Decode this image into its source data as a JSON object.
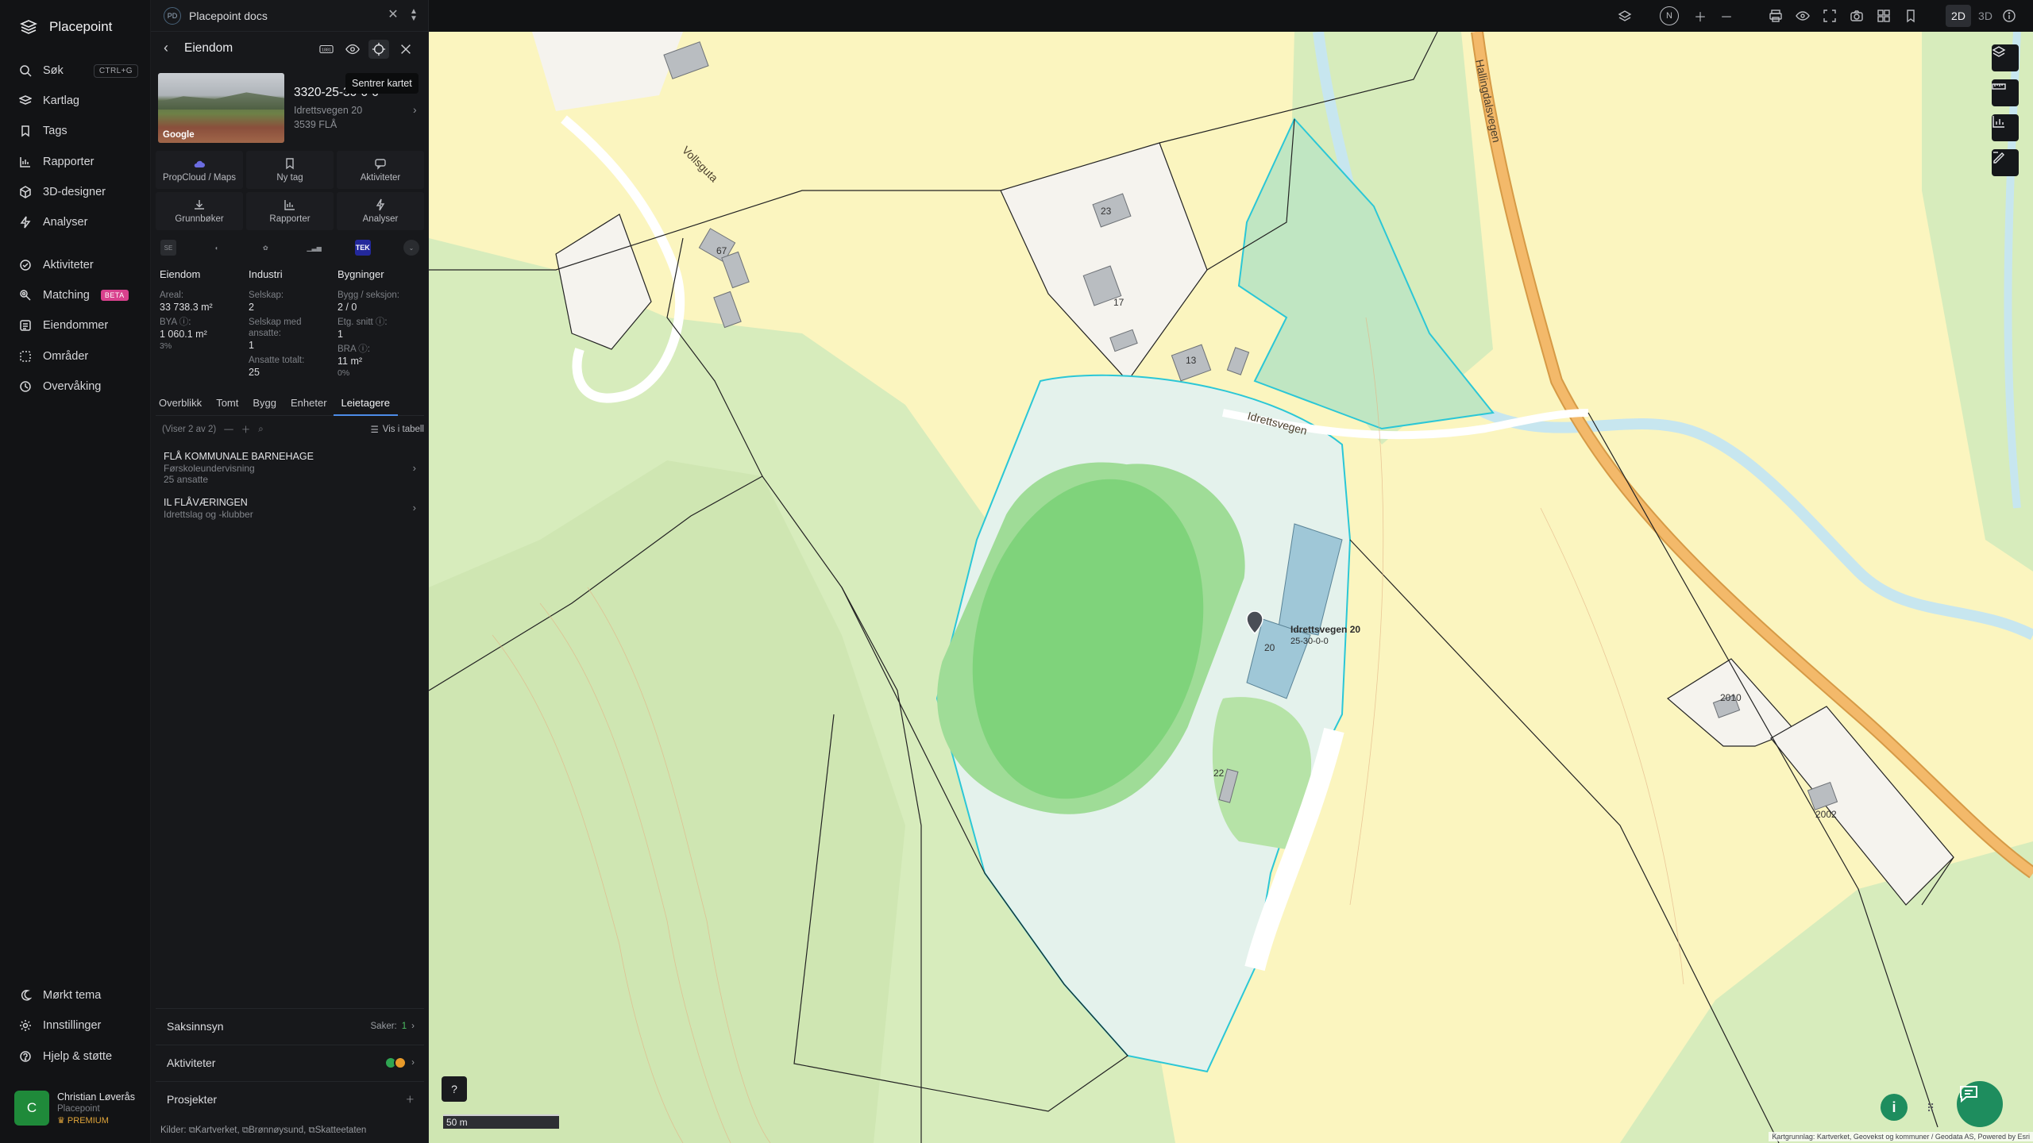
{
  "app": {
    "name": "Placepoint"
  },
  "nav": {
    "items": [
      {
        "label": "Søk",
        "icon": "search-icon",
        "shortcut": "CTRL+G"
      },
      {
        "label": "Kartlag",
        "icon": "layers-icon"
      },
      {
        "label": "Tags",
        "icon": "bookmark-icon"
      },
      {
        "label": "Rapporter",
        "icon": "chart-icon"
      },
      {
        "label": "3D-designer",
        "icon": "cube-icon"
      },
      {
        "label": "Analyser",
        "icon": "bolt-icon"
      },
      {
        "label": "Aktiviteter",
        "icon": "activity-icon"
      },
      {
        "label": "Matching",
        "icon": "target-icon",
        "badge": "BETA"
      },
      {
        "label": "Eiendommer",
        "icon": "list-icon"
      },
      {
        "label": "Områder",
        "icon": "area-icon"
      },
      {
        "label": "Overvåking",
        "icon": "monitor-icon"
      }
    ],
    "bottom": [
      {
        "label": "Mørkt tema",
        "icon": "moon-icon"
      },
      {
        "label": "Innstillinger",
        "icon": "gear-icon"
      },
      {
        "label": "Hjelp & støtte",
        "icon": "help-icon"
      }
    ],
    "user": {
      "initial": "C",
      "name": "Christian Løverås",
      "org": "Placepoint",
      "plan": "PREMIUM"
    }
  },
  "doc_tab": {
    "badge": "PD",
    "title": "Placepoint docs"
  },
  "panel": {
    "title": "Eiendom",
    "tooltip": "Sentrer kartet",
    "property": {
      "id": "3320-25-30-0-0",
      "address": "Idrettsvegen 20",
      "postal": "3539 FLÅ",
      "thumb_label": "Google"
    },
    "actions": [
      "PropCloud / Maps",
      "Ny tag",
      "Aktiviteter",
      "Grunnbøker",
      "Rapporter",
      "Analyser"
    ],
    "source_tek": "TEK",
    "stats": {
      "eiendom": {
        "header": "Eiendom",
        "areal_label": "Areal:",
        "areal": "33 738.3 m²",
        "bya_label": "BYA ⓘ:",
        "bya": "1 060.1 m²",
        "bya_pct": "3%"
      },
      "industri": {
        "header": "Industri",
        "selskap_label": "Selskap:",
        "selskap": "2",
        "ansatte_label": "Selskap med ansatte:",
        "ansatte": "1",
        "totalt_label": "Ansatte totalt:",
        "totalt": "25"
      },
      "bygninger": {
        "header": "Bygninger",
        "bygg_label": "Bygg / seksjon:",
        "bygg": "2 / 0",
        "etg_label": "Etg. snitt ⓘ:",
        "etg": "1",
        "bra_label": "BRA ⓘ:",
        "bra": "11 m²",
        "bra_pct": "0%"
      }
    },
    "subtabs": [
      "Overblikk",
      "Tomt",
      "Bygg",
      "Enheter",
      "Leietagere"
    ],
    "list": {
      "count": "(Viser 2 av 2)",
      "table_link": "Vis i tabell"
    },
    "tenants": [
      {
        "name": "FLÅ KOMMUNALE BARNEHAGE",
        "desc": "Førskoleundervisning",
        "extra": "25 ansatte"
      },
      {
        "name": "IL FLÅVÆRINGEN",
        "desc": "Idrettslag og -klubber",
        "extra": ""
      }
    ],
    "sections": [
      {
        "label": "Saksinnsyn",
        "meta": "Saker:",
        "count": "1"
      },
      {
        "label": "Aktiviteter"
      },
      {
        "label": "Prosjekter"
      }
    ],
    "sources": {
      "label": "Kilder:",
      "items": [
        "Kartverket",
        "Brønnøysund",
        "Skatteetaten"
      ]
    }
  },
  "topbar": {
    "compass": "N",
    "mode_2d": "2D",
    "mode_3d": "3D"
  },
  "map": {
    "roads": [
      "Hallingdalsvegen",
      "Idrettsvegen",
      "Vollsguta"
    ],
    "house_numbers": [
      "23",
      "17",
      "13",
      "67",
      "20",
      "22",
      "2010",
      "2002"
    ],
    "marker": {
      "address": "Idrettsvegen 20",
      "id": "25-30-0-0"
    },
    "scale": "50 m",
    "attribution": "Kartgrunnlag: Kartverket, Geovekst og kommuner / Geodata AS, Powered by Esri"
  }
}
